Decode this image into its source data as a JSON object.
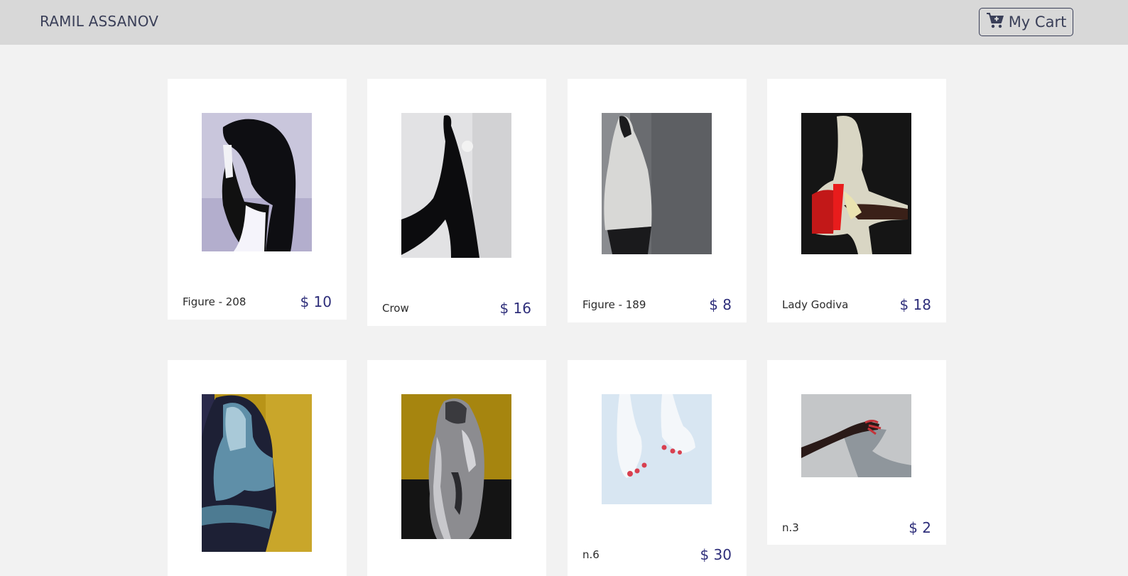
{
  "header": {
    "brand": "RAMIL ASSANOV",
    "cart_label": "My Cart"
  },
  "products": [
    {
      "title": "Figure - 208",
      "price": "$ 10"
    },
    {
      "title": "Crow",
      "price": "$ 16"
    },
    {
      "title": "Figure - 189",
      "price": "$ 8"
    },
    {
      "title": "Lady Godiva",
      "price": "$ 18"
    },
    {
      "title": "",
      "price": ""
    },
    {
      "title": "",
      "price": ""
    },
    {
      "title": "n.6",
      "price": "$ 30"
    },
    {
      "title": "n.3",
      "price": "$ 2"
    }
  ]
}
